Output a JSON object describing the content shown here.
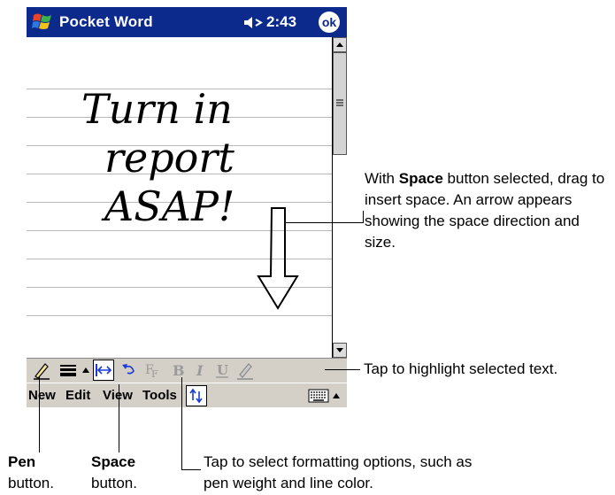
{
  "titlebar": {
    "app_title": "Pocket Word",
    "time": "2:43",
    "ok_label": "ok"
  },
  "document": {
    "handwriting_lines": [
      "Turn in",
      "report",
      "ASAP!"
    ]
  },
  "menubar": {
    "items": [
      "New",
      "Edit",
      "View",
      "Tools"
    ]
  },
  "callouts": {
    "space_note_prefix": "With ",
    "space_note_bold": "Space",
    "space_note_rest": " button selected, drag to insert space. An arrow appears showing the space direction and size.",
    "highlight_note": "Tap to highlight selected text.",
    "format_note": "Tap to select formatting options, such as pen weight and line color.",
    "pen_label_bold": "Pen",
    "pen_label_rest": "button.",
    "space_label_bold": "Space",
    "space_label_rest": "button."
  },
  "colors": {
    "titlebar": "#0b2a8c",
    "toolbar": "#d4d0c8",
    "space_button_accent": "#1a3bd6"
  }
}
